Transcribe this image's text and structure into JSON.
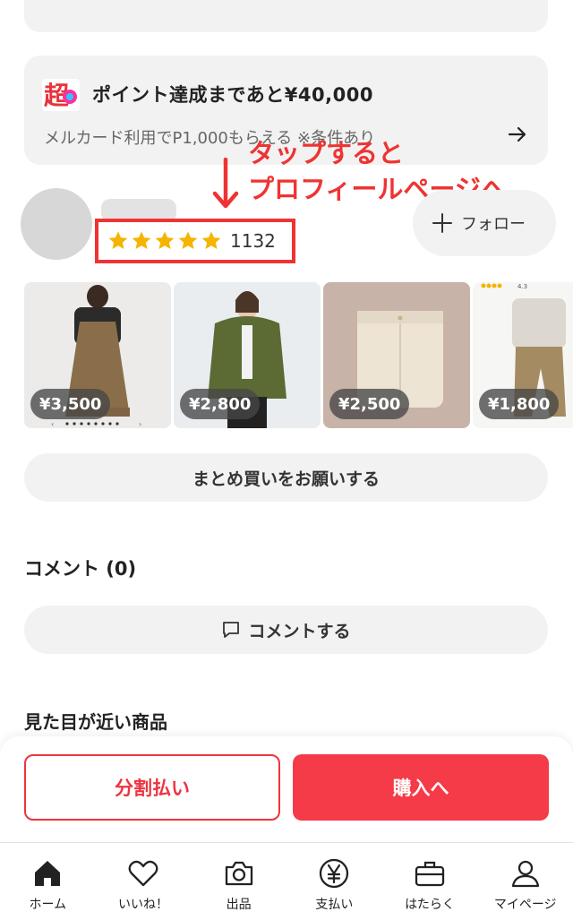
{
  "promo": {
    "logo_char": "超",
    "title": "ポイント達成まであと¥40,000",
    "subtitle": "メルカード利用でP1,000もらえる ※条件あり"
  },
  "annotation": {
    "line1": "タップすると",
    "line2": "プロフィールページへ"
  },
  "seller": {
    "star_count": 5,
    "rating_count": "1132",
    "follow_label": "フォロー"
  },
  "items": [
    {
      "price": "¥3,500"
    },
    {
      "price": "¥2,800"
    },
    {
      "price": "¥2,500"
    },
    {
      "price": "¥1,800"
    }
  ],
  "thumb_overlay": {
    "rating_text": "4.3"
  },
  "bulk_button": "まとめ買いをお願いする",
  "comments": {
    "heading": "コメント (0)",
    "button": "コメントする"
  },
  "similar_heading": "見た目が近い商品",
  "actions": {
    "split_pay": "分割払い",
    "buy": "購入へ"
  },
  "tabs": [
    {
      "label": "ホーム",
      "icon": "home-icon"
    },
    {
      "label": "いいね！",
      "icon": "heart-icon"
    },
    {
      "label": "出品",
      "icon": "camera-icon"
    },
    {
      "label": "支払い",
      "icon": "yen-icon"
    },
    {
      "label": "はたらく",
      "icon": "briefcase-icon"
    },
    {
      "label": "マイページ",
      "icon": "person-icon"
    }
  ],
  "colors": {
    "accent_red": "#ef3340",
    "annotation_red": "#ef3333",
    "star_yellow": "#f5b400",
    "pill_gray": "#f2f2f2"
  }
}
